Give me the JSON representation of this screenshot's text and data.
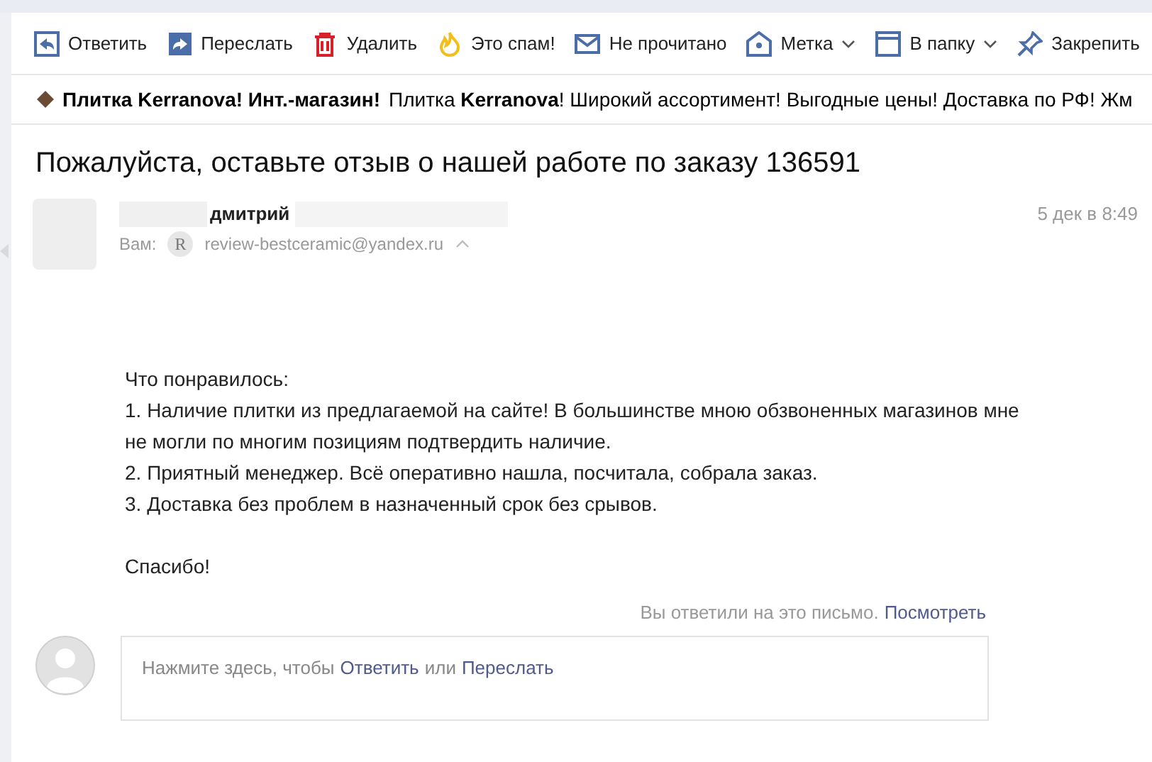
{
  "toolbar": [
    {
      "kind": "reply",
      "label": "Ответить",
      "dropdown": false
    },
    {
      "kind": "forward",
      "label": "Переслать",
      "dropdown": false
    },
    {
      "kind": "delete",
      "label": "Удалить",
      "dropdown": false
    },
    {
      "kind": "spam",
      "label": "Это спам!",
      "dropdown": false
    },
    {
      "kind": "unread",
      "label": "Не прочитано",
      "dropdown": false
    },
    {
      "kind": "label",
      "label": "Метка",
      "dropdown": true
    },
    {
      "kind": "folder",
      "label": "В папку",
      "dropdown": true
    },
    {
      "kind": "pin",
      "label": "Закрепить",
      "dropdown": false
    }
  ],
  "ad": {
    "sender": "Плитка Kerranova! Инт.-магазин!",
    "text": "Плитка **Kerranova**! Широкий ассортимент! Выгодные цены! Доставка по РФ! Жм"
  },
  "subject": "Пожалуйста, оставьте отзыв о нашей работе по заказу 136591",
  "message": {
    "sender_name": "дмитрий",
    "date": "5 дек в 8:49",
    "to_label": "Вам:",
    "to_initial": "R",
    "to_address": "review-bestceramic@yandex.ru"
  },
  "body": [
    [
      "Что понравилось:",
      "1. Наличие плитки из предлагаемой на сайте! В большинстве мною обзвоненных магазинов мне не могли по многим позициям подтвердить наличие.",
      "2. Приятный менеджер. Всё оперативно нашла, посчитала, собрала заказ.",
      "3. Доставка без проблем в назначенный срок без срывов."
    ],
    [
      "Спасибо!"
    ]
  ],
  "replied_notice": {
    "text": "Вы ответили на это письмо.",
    "link": "Посмотреть"
  },
  "quick_reply": {
    "prefix": "Нажмите здесь, чтобы",
    "reply": "Ответить",
    "or": "или",
    "forward": "Переслать"
  }
}
